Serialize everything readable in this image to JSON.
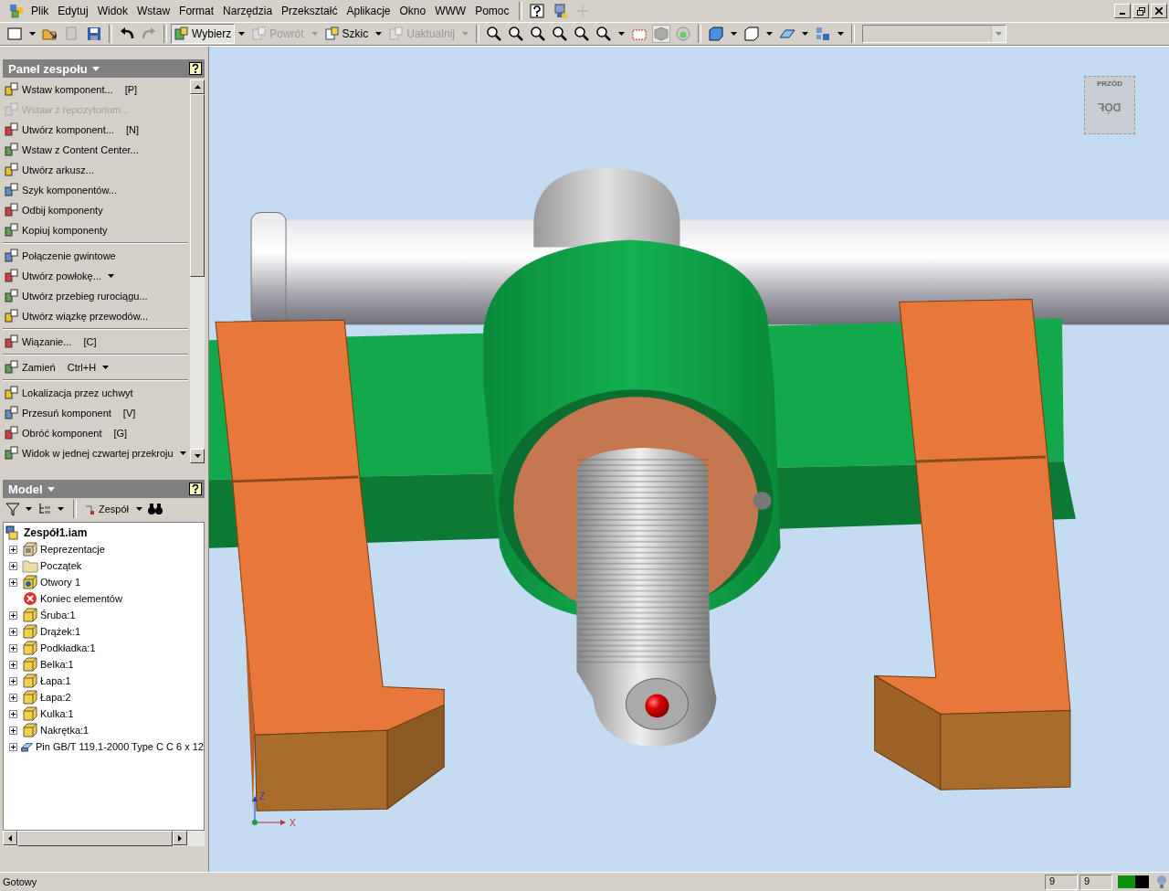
{
  "menu_bar": {
    "items": [
      "Plik",
      "Edytuj",
      "Widok",
      "Wstaw",
      "Format",
      "Narzędzia",
      "Przekształć",
      "Aplikacje",
      "Okno",
      "WWW",
      "Pomoc"
    ]
  },
  "toolbar": {
    "buttons": [
      {
        "label": "Wybierz",
        "selected": true,
        "disabled": false
      },
      {
        "label": "Powrót",
        "selected": false,
        "disabled": true
      },
      {
        "label": "Szkic",
        "selected": false,
        "disabled": false
      },
      {
        "label": "Uaktualnij",
        "selected": false,
        "disabled": true
      }
    ]
  },
  "assembly_panel": {
    "title": "Panel zespołu",
    "groups": [
      [
        {
          "label": "Wstaw komponent...",
          "shortcut": "[P]",
          "disabled": false,
          "dropdown": false
        },
        {
          "label": "Wstaw z repozytorium...",
          "disabled": true,
          "dropdown": false
        },
        {
          "label": "Utwórz komponent...",
          "shortcut": "[N]",
          "disabled": false,
          "dropdown": false
        },
        {
          "label": "Wstaw z Content Center...",
          "disabled": false,
          "dropdown": false
        },
        {
          "label": "Utwórz arkusz...",
          "disabled": false,
          "dropdown": false
        },
        {
          "label": "Szyk komponentów...",
          "disabled": false,
          "dropdown": false
        },
        {
          "label": "Odbij komponenty",
          "disabled": false,
          "dropdown": false
        },
        {
          "label": "Kopiuj komponenty",
          "disabled": false,
          "dropdown": false
        }
      ],
      [
        {
          "label": "Połączenie gwintowe",
          "disabled": false,
          "dropdown": false
        },
        {
          "label": "Utwórz powłokę...",
          "disabled": false,
          "dropdown": true
        },
        {
          "label": "Utwórz przebieg rurociągu...",
          "disabled": false,
          "dropdown": false
        },
        {
          "label": "Utwórz wiązkę przewodów...",
          "disabled": false,
          "dropdown": false
        }
      ],
      [
        {
          "label": "Wiązanie...",
          "shortcut": "[C]",
          "disabled": false,
          "dropdown": false
        }
      ],
      [
        {
          "label": "Zamień",
          "shortcut": "Ctrl+H",
          "disabled": false,
          "dropdown": true
        }
      ],
      [
        {
          "label": "Lokalizacja przez uchwyt",
          "disabled": false,
          "dropdown": false
        },
        {
          "label": "Przesuń komponent",
          "shortcut": "[V]",
          "disabled": false,
          "dropdown": false
        },
        {
          "label": "Obróć komponent",
          "shortcut": "[G]",
          "disabled": false,
          "dropdown": false
        },
        {
          "label": "Widok w jednej czwartej przekroju",
          "disabled": false,
          "dropdown": true
        }
      ]
    ]
  },
  "model_panel": {
    "title": "Model",
    "toolbar_label": "Zespół",
    "tree": {
      "label": "Zespół1.iam",
      "children": [
        {
          "label": "Reprezentacje",
          "kind": "representations",
          "expanded": false
        },
        {
          "label": "Początek",
          "kind": "folder",
          "expanded": false
        },
        {
          "label": "Otwory 1",
          "kind": "feature",
          "expanded": false
        },
        {
          "label": "Koniec elementów",
          "kind": "end",
          "expanded": false
        },
        {
          "label": "Śruba:1",
          "kind": "part",
          "expanded": false
        },
        {
          "label": "Drążek:1",
          "kind": "part",
          "expanded": false
        },
        {
          "label": "Podkładka:1",
          "kind": "part",
          "expanded": false
        },
        {
          "label": "Belka:1",
          "kind": "part",
          "expanded": false
        },
        {
          "label": "Łapa:1",
          "kind": "part",
          "expanded": false
        },
        {
          "label": "Łapa:2",
          "kind": "part",
          "expanded": false
        },
        {
          "label": "Kulka:1",
          "kind": "part",
          "expanded": false
        },
        {
          "label": "Nakrętka:1",
          "kind": "part",
          "expanded": false
        },
        {
          "label": "Pin GB/T 119.1-2000 Type C C 6 x 12",
          "kind": "content_part",
          "expanded": false
        }
      ]
    }
  },
  "view_cube": {
    "top_label": "PRZÓD",
    "front_label": "DÓŁ"
  },
  "axis_triad": {
    "x_label": "X",
    "z_label": "Z"
  },
  "status_bar": {
    "text": "Gotowy",
    "fields": [
      "9",
      "9"
    ],
    "memory": {
      "level": 0.55
    }
  }
}
